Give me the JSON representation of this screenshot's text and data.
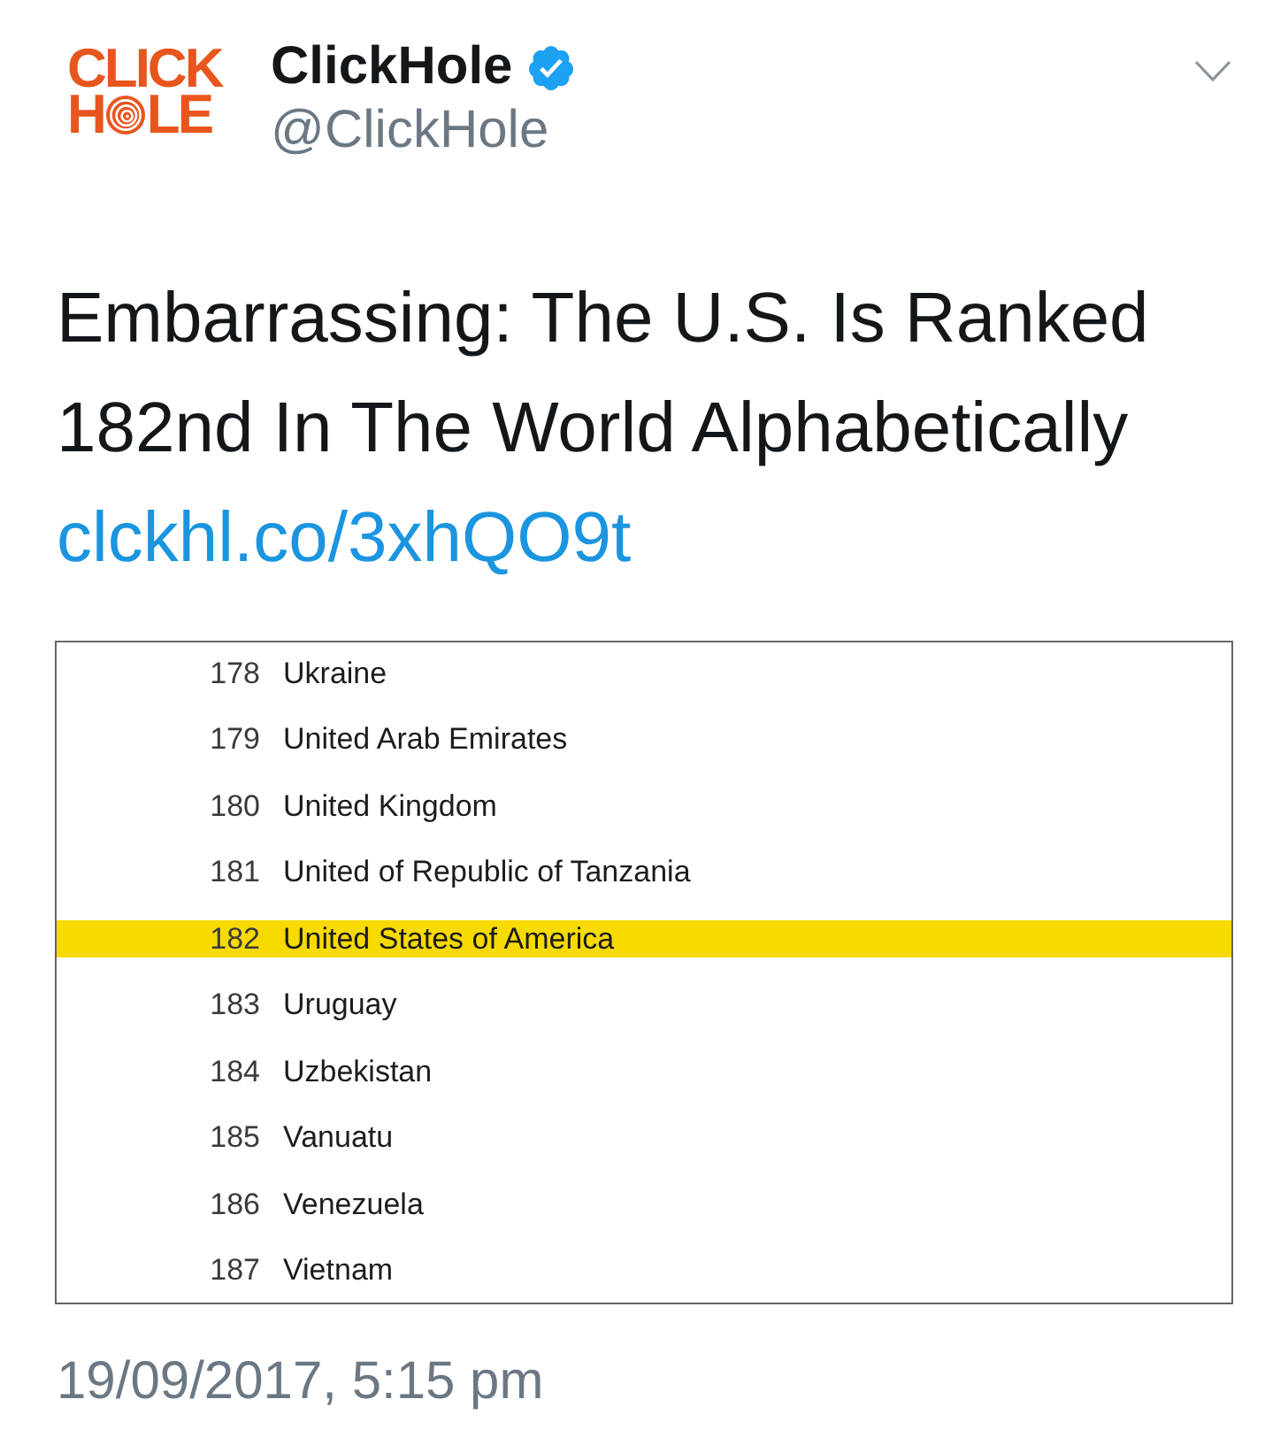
{
  "tweet_header": {
    "logo": {
      "top_line": "CLICK",
      "bottom_line_start": "H",
      "bottom_line_end": "LE"
    },
    "display_name": "ClickHole",
    "verified": true,
    "handle": "@ClickHole"
  },
  "tweet": {
    "text": "Embarrassing: The U.S. Is Ranked 182nd In The World Alphabetically",
    "link": "clckhl.co/3xhQO9t"
  },
  "ranking_table": {
    "rows": [
      {
        "rank": "178",
        "country": "Ukraine",
        "highlighted": false
      },
      {
        "rank": "179",
        "country": "United Arab Emirates",
        "highlighted": false
      },
      {
        "rank": "180",
        "country": "United Kingdom",
        "highlighted": false
      },
      {
        "rank": "181",
        "country": "United of Republic of Tanzania",
        "highlighted": false
      },
      {
        "rank": "182",
        "country": "United States of America",
        "highlighted": true
      },
      {
        "rank": "183",
        "country": "Uruguay",
        "highlighted": false
      },
      {
        "rank": "184",
        "country": "Uzbekistan",
        "highlighted": false
      },
      {
        "rank": "185",
        "country": "Vanuatu",
        "highlighted": false
      },
      {
        "rank": "186",
        "country": "Venezuela",
        "highlighted": false
      },
      {
        "rank": "187",
        "country": "Vietnam",
        "highlighted": false
      }
    ]
  },
  "timestamp": "19/09/2017, 5:15 pm"
}
